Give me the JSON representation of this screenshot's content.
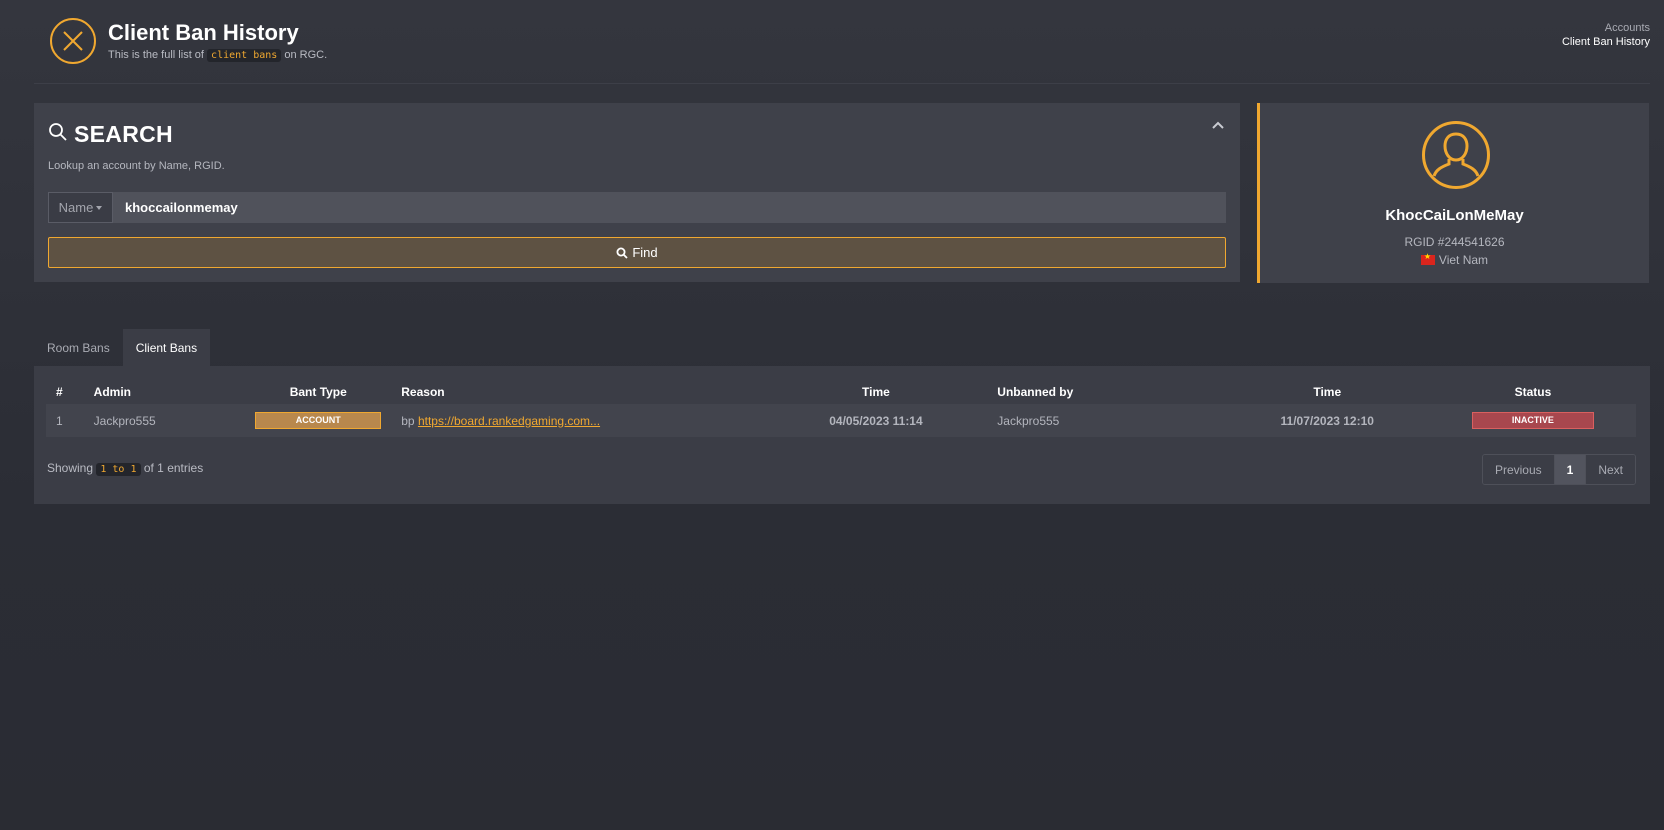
{
  "header": {
    "title": "Client Ban History",
    "subtitle_pre": "This is the full list of",
    "subtitle_code": "client bans",
    "subtitle_post": "on RGC.",
    "breadcrumb": [
      "Accounts",
      "Client Ban History"
    ]
  },
  "search": {
    "title": "SEARCH",
    "help": "Lookup an account by Name, RGID.",
    "type_label": "Name",
    "input_value": "khoccailonmemay",
    "find_label": "Find"
  },
  "profile": {
    "name": "KhocCaiLonMeMay",
    "rgid": "RGID #244541626",
    "country": "Viet Nam"
  },
  "tabs": [
    {
      "label": "Room Bans",
      "active": false
    },
    {
      "label": "Client Bans",
      "active": true
    }
  ],
  "table": {
    "columns": [
      "#",
      "Admin",
      "Bant Type",
      "Reason",
      "Time",
      "Unbanned by",
      "Time",
      "Status"
    ],
    "rows": [
      {
        "num": "1",
        "admin": "Jackpro555",
        "ban_type": "ACCOUNT",
        "reason_prefix": "bp",
        "reason_link": "https://board.rankedgaming.com...",
        "time": "04/05/2023 11:14",
        "unbanned_by": "Jackpro555",
        "unban_time": "11/07/2023 12:10",
        "status": "INACTIVE"
      }
    ]
  },
  "footer": {
    "showing_pre": "Showing",
    "showing_range": "1 to 1",
    "showing_post": "of 1 entries"
  },
  "pagination": {
    "previous": "Previous",
    "current": "1",
    "next": "Next"
  },
  "colors": {
    "accent": "#f0a830",
    "inactive": "#a8474e",
    "background": "#2e3038"
  }
}
